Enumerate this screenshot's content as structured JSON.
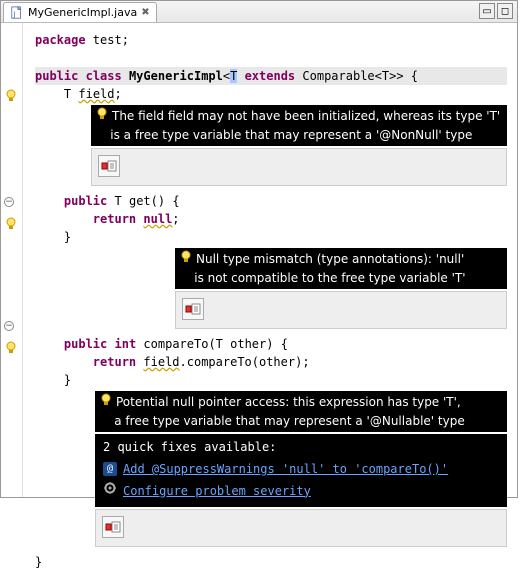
{
  "tab": {
    "title": "MyGenericImpl.java"
  },
  "code": {
    "l1_kw1": "package",
    "l1_rest": " test;",
    "l3_kw1": "public",
    "l3_kw2": "class",
    "l3_cls": "MyGenericImpl",
    "l3_open": "<",
    "l3_T": "T",
    "l3_kw3": "extends",
    "l3_cmp": "Comparable",
    "l3_tail": "<T>> {",
    "l4_T": "T",
    "l4_field": "field",
    "l4_end": ";",
    "l6_kw1": "public",
    "l6_T": "T",
    "l6_fn": "get",
    "l6_rest": "() {",
    "l7_kw1": "return",
    "l7_kw2": "null",
    "l7_end": ";",
    "l8": "}",
    "l10_kw1": "public",
    "l10_kw2": "int",
    "l10_fn": "compareTo",
    "l10_arg": "(T other) {",
    "l11_kw1": "return",
    "l11_field": "field",
    "l11_mid": ".compareTo(other);",
    "l12": "}",
    "l13": "}"
  },
  "tips": {
    "t1": "The field field may not have been initialized, whereas its type 'T'",
    "t1b": "is a free type variable that may represent a '@NonNull' type",
    "t2": "Null type mismatch (type annotations): 'null'",
    "t2b": "is not compatible to the free type variable 'T'",
    "t3": "Potential null pointer access: this expression has type 'T',",
    "t3b": "a free type variable that may represent a '@Nullable' type"
  },
  "quickfix": {
    "header": "2 quick fixes available:",
    "fix1": "Add @SuppressWarnings 'null' to 'compareTo()'",
    "fix2": "Configure problem severity"
  }
}
